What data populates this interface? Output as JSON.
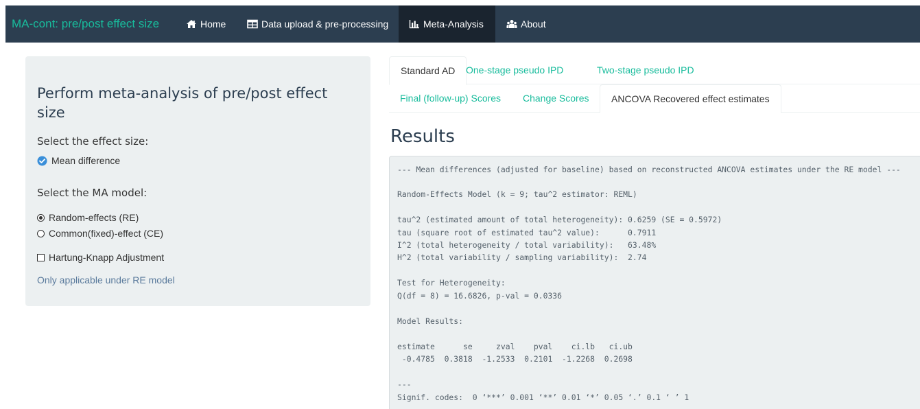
{
  "navbar": {
    "brand": "MA-cont: pre/post effect size",
    "items": [
      {
        "label": "Home",
        "icon": "home-icon"
      },
      {
        "label": "Data upload & pre-processing",
        "icon": "table-icon"
      },
      {
        "label": "Meta-Analysis",
        "icon": "bar-chart-icon"
      },
      {
        "label": "About",
        "icon": "users-icon"
      }
    ],
    "active": "Meta-Analysis"
  },
  "sidebar": {
    "title": "Perform meta-analysis of pre/post effect size",
    "effect_label": "Select the effect size:",
    "effect_option": "Mean difference",
    "model_label": "Select the MA model:",
    "model_options": [
      "Random-effects (RE)",
      "Common(fixed)-effect (CE)"
    ],
    "model_selected": "Random-effects (RE)",
    "hk_label": "Hartung-Knapp Adjustment",
    "hk_checked": false,
    "note": "Only applicable under RE model"
  },
  "tabs_top": {
    "items": [
      "Standard AD",
      "One-stage pseudo IPD",
      "Two-stage pseudo IPD"
    ],
    "active": "Standard AD"
  },
  "tabs_sub": {
    "items": [
      "Final (follow-up) Scores",
      "Change Scores",
      "ANCOVA Recovered effect estimates"
    ],
    "active": "ANCOVA Recovered effect estimates"
  },
  "results": {
    "title": "Results",
    "lines": [
      "--- Mean differences (adjusted for baseline) based on reconstructed ANCOVA estimates under the RE model ---",
      "Random-Effects Model (k = 9; tau^2 estimator: REML)",
      "tau^2 (estimated amount of total heterogeneity): 0.6259 (SE = 0.5972)",
      "tau (square root of estimated tau^2 value):      0.7911",
      "I^2 (total heterogeneity / total variability):   63.48%",
      "H^2 (total variability / sampling variability):  2.74",
      "Test for Heterogeneity:",
      "Q(df = 8) = 16.6826, p-val = 0.0336",
      "Model Results:",
      "estimate      se     zval    pval    ci.lb   ci.ub",
      " -0.4785  0.3818  -1.2533  0.2101  -1.2268  0.2698",
      "---",
      "Signif. codes:  0 ‘***’ 0.001 ‘**’ 0.01 ‘*’ 0.05 ‘.’ 0.1 ‘ ’ 1"
    ]
  },
  "colors": {
    "navbar_bg": "#2c3e50",
    "brand": "#18bc9c",
    "panel_bg": "#ecf0f1",
    "link": "#18bc9c",
    "checked_icon": "#3a8fd9"
  }
}
